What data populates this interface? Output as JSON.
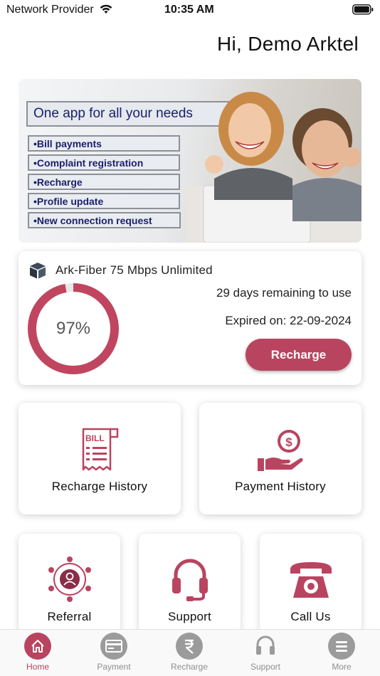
{
  "status_bar": {
    "carrier": "Network Provider",
    "time": "10:35 AM"
  },
  "header": {
    "greeting": "Hi, Demo Arktel"
  },
  "banner": {
    "headline": "One app for all your needs",
    "features": [
      "•Bill payments",
      "•Complaint registration",
      "•Recharge",
      "•Profile update",
      "•New connection request"
    ]
  },
  "plan": {
    "name": "Ark-Fiber 75 Mbps Unlimited",
    "usage_percent": 97,
    "usage_label": "97%",
    "days_remaining": "29 days remaining to use",
    "expiry": "Expired on: 22-09-2024",
    "recharge_label": "Recharge"
  },
  "tiles": {
    "recharge_history": "Recharge History",
    "payment_history": "Payment History",
    "referral": "Referral",
    "support": "Support",
    "call_us": "Call Us",
    "bill_icon_text": "BILL"
  },
  "nav": {
    "home": "Home",
    "payment": "Payment",
    "recharge": "Recharge",
    "support": "Support",
    "more": "More"
  },
  "colors": {
    "accent": "#b94460",
    "ring": "#c0465f",
    "inactive": "#9b9b9b"
  }
}
